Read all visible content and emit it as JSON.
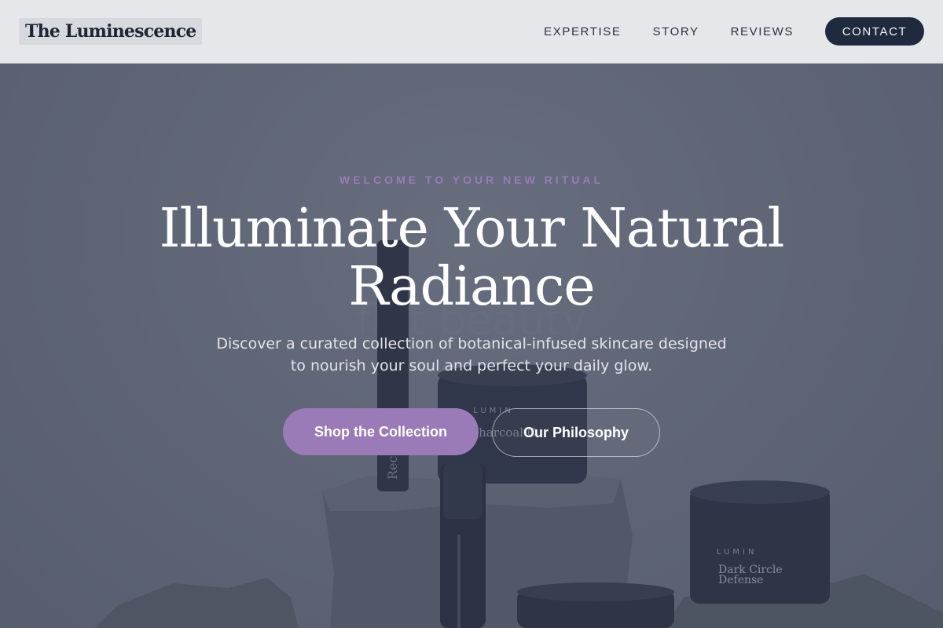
{
  "header": {
    "brand": "The Luminescence",
    "nav": [
      "EXPERTISE",
      "STORY",
      "REVIEWS"
    ],
    "cta": "CONTACT"
  },
  "hero": {
    "eyebrow": "WELCOME TO YOUR NEW RITUAL",
    "headline_line1": "Illuminate Your Natural",
    "headline_line2": "Radiance",
    "subtext_line1": "Discover a curated collection of botanical-infused skincare designed",
    "subtext_line2": "to nourish your soul and perfect your daily glow.",
    "primary_button": "Shop the Collection",
    "secondary_button": "Our Philosophy"
  },
  "products": {
    "brand_mark": "LUMIN",
    "jar_center_label": "Charcoal C",
    "tube_label": "Rec",
    "jar_right_line1": "Dark Circle",
    "jar_right_line2": "Defense",
    "watermark": "flat beauty"
  },
  "colors": {
    "accent": "#9a7bb8",
    "nav_cta": "#1f2a3e",
    "nav_bg": "#e6e7ea"
  }
}
